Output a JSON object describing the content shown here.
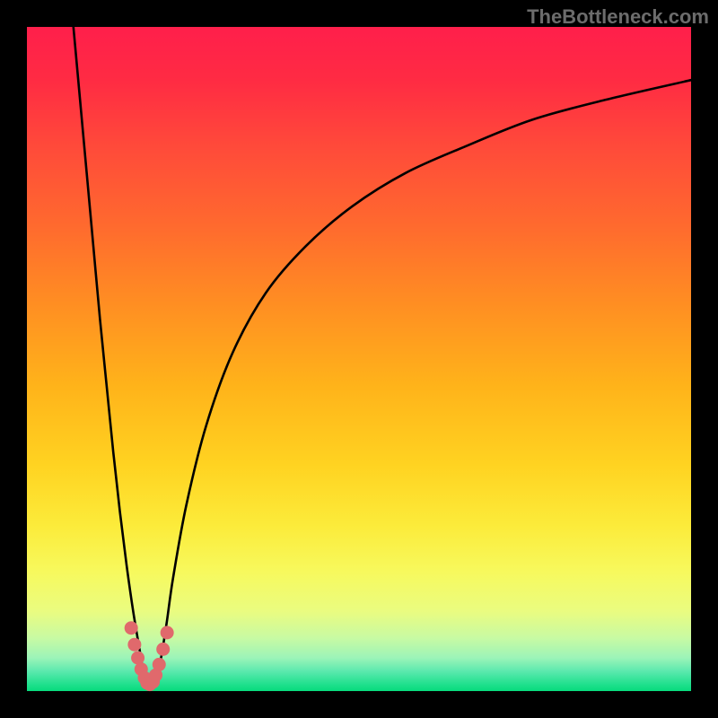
{
  "watermark": "TheBottleneck.com",
  "chart_data": {
    "type": "line",
    "title": "",
    "xlabel": "",
    "ylabel": "",
    "xlim": [
      0,
      100
    ],
    "ylim": [
      0,
      100
    ],
    "grid": false,
    "series": [
      {
        "name": "bottleneck-curve",
        "x": [
          7,
          8,
          9,
          10,
          11,
          12,
          13,
          14,
          15,
          16,
          17,
          17.5,
          18,
          18.5,
          19,
          20,
          21,
          22,
          24,
          27,
          31,
          36,
          42,
          49,
          57,
          66,
          76,
          87,
          100
        ],
        "y": [
          100,
          89,
          78,
          67,
          56,
          46,
          36,
          27,
          19,
          12,
          6,
          3,
          1,
          0.5,
          1,
          4,
          10,
          17,
          28,
          40,
          51,
          60,
          67,
          73,
          78,
          82,
          86,
          89,
          92
        ]
      }
    ],
    "highlight_points": {
      "name": "valley-dots",
      "x": [
        15.7,
        16.2,
        16.7,
        17.2,
        17.7,
        18.1,
        18.5,
        19.0,
        19.4,
        19.9,
        20.5,
        21.1
      ],
      "y": [
        9.5,
        7.0,
        5.0,
        3.3,
        2.0,
        1.2,
        1.0,
        1.4,
        2.4,
        4.0,
        6.3,
        8.8
      ]
    },
    "gradient_stops": [
      {
        "pos": 0.0,
        "color": "#ff1f4b"
      },
      {
        "pos": 0.3,
        "color": "#ff6a2e"
      },
      {
        "pos": 0.66,
        "color": "#ffd321"
      },
      {
        "pos": 0.82,
        "color": "#f7f95d"
      },
      {
        "pos": 0.95,
        "color": "#9cf4b8"
      },
      {
        "pos": 1.0,
        "color": "#07db7c"
      }
    ]
  }
}
